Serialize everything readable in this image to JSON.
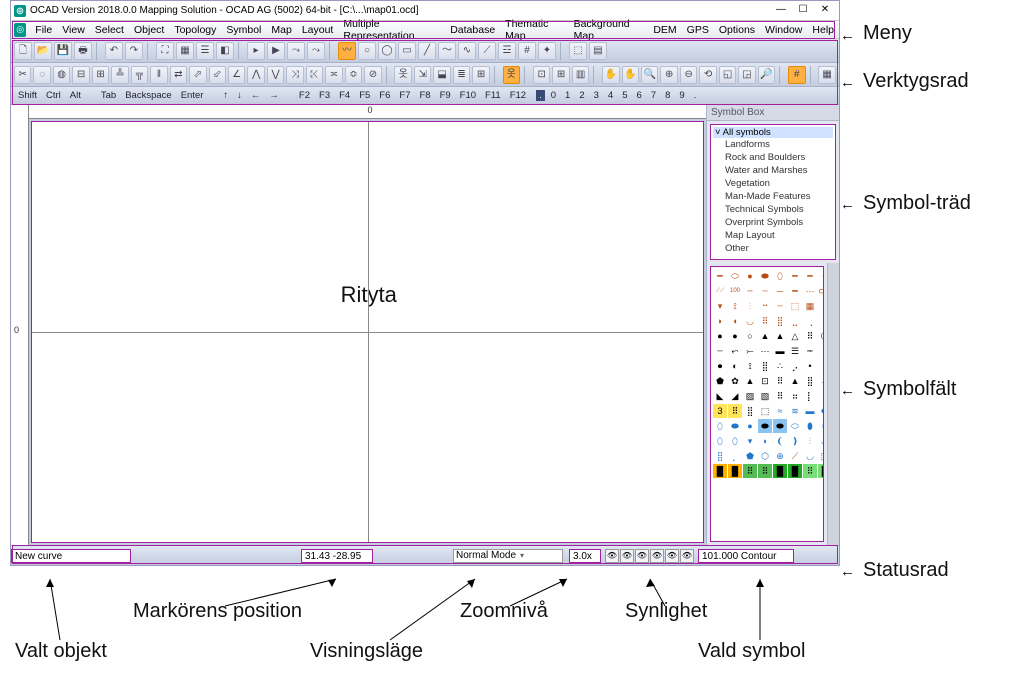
{
  "title": "OCAD Version 2018.0.0  Mapping Solution - OCAD AG (5002) 64-bit - [C:\\...\\map01.ocd]",
  "menu": [
    "File",
    "View",
    "Select",
    "Object",
    "Topology",
    "Symbol",
    "Map",
    "Layout",
    "Multiple Representation",
    "Database",
    "Thematic Map",
    "Background Map",
    "DEM",
    "GPS",
    "Options",
    "Window",
    "Help"
  ],
  "keyrow": {
    "mods": [
      "Shift",
      "Ctrl",
      "Alt"
    ],
    "edit": [
      "Tab",
      "Backspace",
      "Enter"
    ],
    "arrs": [
      "↑",
      "↓",
      "←",
      "→"
    ],
    "fns": [
      "F2",
      "F3",
      "F4",
      "F5",
      "F6",
      "F7",
      "F8",
      "F9",
      "F10",
      "F11",
      "F12"
    ],
    "dot": ".",
    "nums": [
      "0",
      "1",
      "2",
      "3",
      "4",
      "5",
      "6",
      "7",
      "8",
      "9",
      ".",
      " "
    ]
  },
  "ruler_h": "0",
  "ruler_v": "0",
  "canvas_label": "Rityta",
  "side_title": "Symbol Box",
  "tree_root": "All symbols",
  "tree": [
    "Landforms",
    "Rock and Boulders",
    "Water and Marshes",
    "Vegetation",
    "Man-Made Features",
    "Technical Symbols",
    "Overprint Symbols",
    "Map Layout",
    "Other"
  ],
  "status": {
    "selected": "New curve",
    "coords": "31.43  -28.95",
    "mode": "Normal Mode",
    "zoom": "3.0x",
    "symbol": "101.000 Contour"
  },
  "callouts": {
    "menu": "Meny",
    "toolbar": "Verktygsrad",
    "tree": "Symbol-träd",
    "palette": "Symbolfält",
    "statusbar": "Statusrad",
    "selected": "Valt objekt",
    "cursor": "Markörens position",
    "viewmode": "Visningsläge",
    "zoom": "Zoomnivå",
    "visibility": "Synlighet",
    "symbol": "Vald symbol"
  },
  "colors": {
    "accent": "#a020a0",
    "tool": "#c4cddf",
    "brown": "#b74d12",
    "blue": "#2277cc"
  }
}
